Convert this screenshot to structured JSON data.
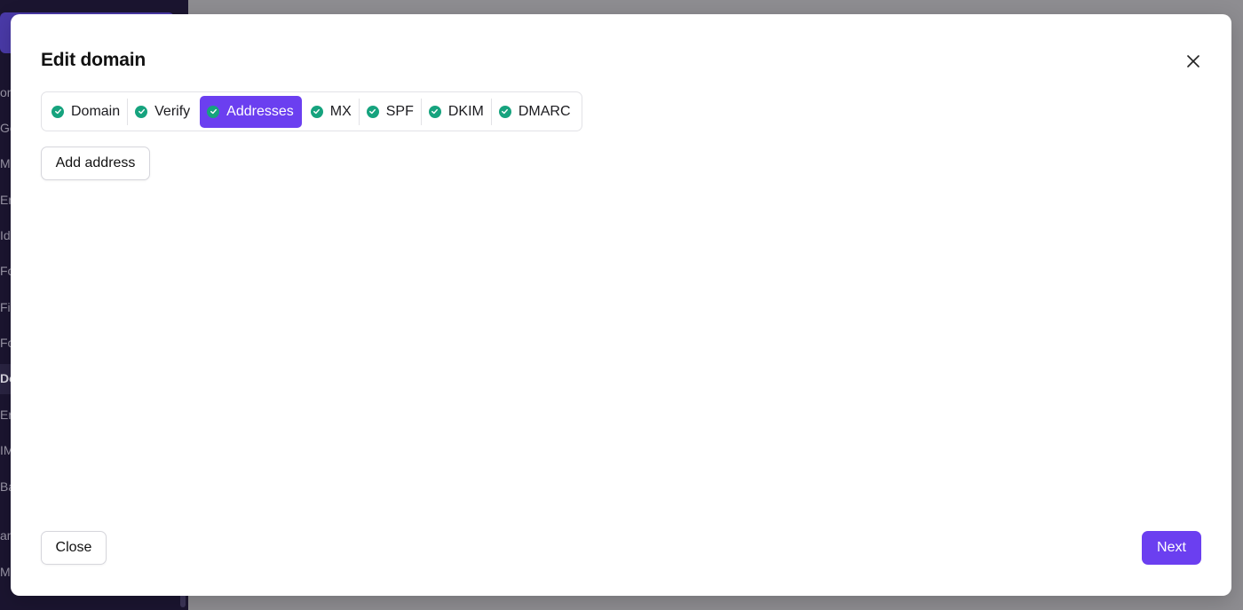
{
  "background": {
    "sidebar_items": [
      {
        "label": "on"
      },
      {
        "label": "Ge"
      },
      {
        "label": "M"
      },
      {
        "label": "Er"
      },
      {
        "label": "Id"
      },
      {
        "label": "Fo"
      },
      {
        "label": "Fi"
      },
      {
        "label": "Fo"
      },
      {
        "label": "Do"
      },
      {
        "label": "Er"
      },
      {
        "label": "IM"
      },
      {
        "label": "Ba"
      },
      {
        "label": "an"
      },
      {
        "label": "M"
      }
    ]
  },
  "modal": {
    "title": "Edit domain",
    "close_icon": "close-icon",
    "steps": [
      {
        "label": "Domain",
        "status": "complete",
        "active": false
      },
      {
        "label": "Verify",
        "status": "complete",
        "active": false
      },
      {
        "label": "Addresses",
        "status": "complete",
        "active": true
      },
      {
        "label": "MX",
        "status": "complete",
        "active": false
      },
      {
        "label": "SPF",
        "status": "complete",
        "active": false
      },
      {
        "label": "DKIM",
        "status": "complete",
        "active": false
      },
      {
        "label": "DMARC",
        "status": "complete",
        "active": false
      }
    ],
    "add_address_label": "Add address",
    "close_label": "Close",
    "next_label": "Next"
  },
  "colors": {
    "accent": "#6b3ff0",
    "check": "#16a37e",
    "overlay": "#8e8d91",
    "sidebar": "#1b1530"
  }
}
